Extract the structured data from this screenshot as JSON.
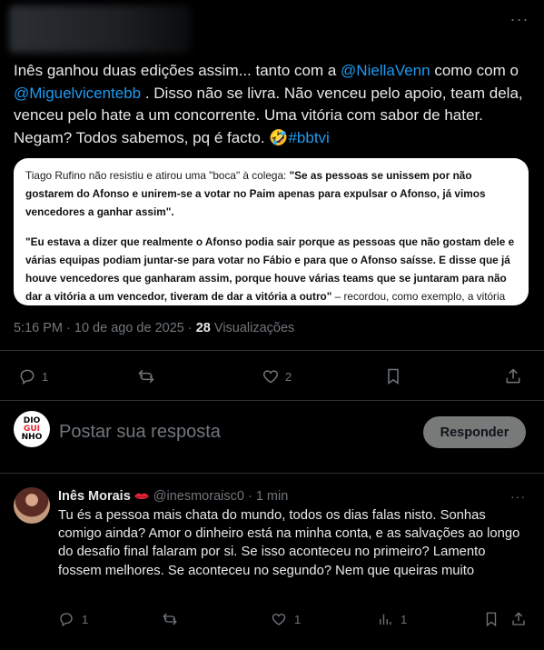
{
  "tweet": {
    "text_parts": {
      "p1": "Inês ganhou duas edições assim... tanto com a ",
      "mention1": "@NiellaVenn",
      "p2": "  como com o ",
      "mention2": "@Miguelvicentebb",
      "p3": " . Disso não se livra. Não venceu pelo apoio, team dela, venceu pelo hate a um concorrente.   Uma vitória com sabor de hater. Negam? Todos sabemos, pq é facto. 🤣",
      "hashtag": "#bbtvi"
    },
    "quote": {
      "p1_plain": "Tiago Rufino não resistiu e atirou uma \"boca\" à colega: ",
      "p1_bold": "\"Se as pessoas se unissem por não gostarem do Afonso e unirem-se a votar no Paim apenas para expulsar o Afonso, já vimos vencedores a ganhar assim\".",
      "p2_bold": "\"Eu estava a dizer que realmente o Afonso podia sair porque as pessoas que não gostam dele e várias equipas podiam juntar-se para votar no Fábio e para que o Afonso saísse. E disse que já houve vencedores que ganharam assim, porque houve várias teams que se juntaram para não dar a vitória a um vencedor, tiveram de dar a vitória a outro\"",
      "p2_plain": " – recordou, como exemplo, a vitória de"
    },
    "meta": {
      "time": "5:16 PM",
      "dot": " · ",
      "date": "10 de ago de 2025",
      "dot2": " · ",
      "views_count": "28",
      "views_label": " Visualizações"
    },
    "actions": {
      "replies": "1",
      "reposts": "",
      "likes": "2"
    }
  },
  "composer": {
    "avatar_lines": [
      "DIO",
      "GUI",
      "NHO"
    ],
    "placeholder": "Postar sua resposta",
    "button": "Responder"
  },
  "reply": {
    "name": "Inês Morais",
    "handle": "@inesmoraisc0",
    "dot": " · ",
    "time": "1 min",
    "text": "Tu és a pessoa mais chata do mundo, todos os dias falas nisto. Sonhas comigo ainda? Amor o dinheiro está na minha conta, e as salvações ao longo do desafio final falaram por si. Se isso aconteceu no primeiro? Lamento fossem melhores. Se aconteceu no segundo? Nem que queiras muito",
    "actions": {
      "replies": "1",
      "likes": "1",
      "views": "1"
    }
  },
  "colors": {
    "background": "#000000",
    "accent": "#1d9bf0",
    "muted": "#71767b",
    "text": "#e7e9ea",
    "reply_button_bg": "#787a7a"
  },
  "icons": [
    "more-icon",
    "reply-icon",
    "repost-icon",
    "like-icon",
    "bookmark-icon",
    "share-icon",
    "views-icon",
    "lips-icon"
  ]
}
